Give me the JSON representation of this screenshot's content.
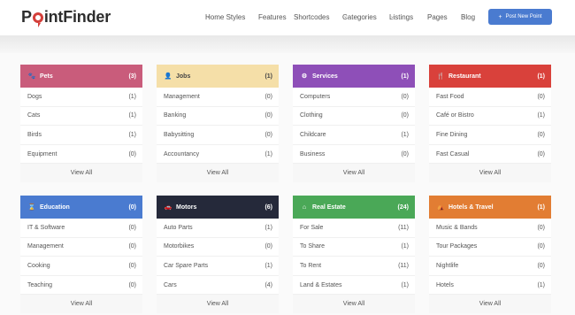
{
  "brand": {
    "name_before": "P",
    "name_after": "intFinder"
  },
  "nav": [
    {
      "label": "Home Styles",
      "dropdown": true
    },
    {
      "label": "Features",
      "dropdown": false
    },
    {
      "label": "Shortcodes",
      "dropdown": true
    },
    {
      "label": "Categories",
      "dropdown": true
    },
    {
      "label": "Listings",
      "dropdown": true
    },
    {
      "label": "Pages",
      "dropdown": true
    },
    {
      "label": "Blog",
      "dropdown": true
    }
  ],
  "post_button": {
    "label": "Post New Point"
  },
  "view_all_label": "View All",
  "categories": [
    {
      "title": "Pets",
      "count": "(3)",
      "color": "#c95c7b",
      "icon": "paw-icon",
      "glyph": "🐾",
      "items": [
        {
          "name": "Dogs",
          "count": "(1)"
        },
        {
          "name": "Cats",
          "count": "(1)"
        },
        {
          "name": "Birds",
          "count": "(1)"
        },
        {
          "name": "Equipment",
          "count": "(0)"
        }
      ]
    },
    {
      "title": "Jobs",
      "count": "(1)",
      "color": "#f5dfa8",
      "text_color": "#444",
      "icon": "user-icon",
      "glyph": "👤",
      "items": [
        {
          "name": "Management",
          "count": "(0)"
        },
        {
          "name": "Banking",
          "count": "(0)"
        },
        {
          "name": "Babysitting",
          "count": "(0)"
        },
        {
          "name": "Accountancy",
          "count": "(1)"
        }
      ]
    },
    {
      "title": "Services",
      "count": "(1)",
      "color": "#8e4fb8",
      "icon": "gears-icon",
      "glyph": "⚙",
      "items": [
        {
          "name": "Computers",
          "count": "(0)"
        },
        {
          "name": "Clothing",
          "count": "(0)"
        },
        {
          "name": "Childcare",
          "count": "(1)"
        },
        {
          "name": "Business",
          "count": "(0)"
        }
      ]
    },
    {
      "title": "Restaurant",
      "count": "(1)",
      "color": "#d9413b",
      "icon": "cutlery-icon",
      "glyph": "🍴",
      "items": [
        {
          "name": "Fast Food",
          "count": "(0)"
        },
        {
          "name": "Café or Bistro",
          "count": "(1)"
        },
        {
          "name": "Fine Dining",
          "count": "(0)"
        },
        {
          "name": "Fast Casual",
          "count": "(0)"
        }
      ]
    },
    {
      "title": "Education",
      "count": "(0)",
      "color": "#4a7bd0",
      "icon": "hourglass-icon",
      "glyph": "⌛",
      "items": [
        {
          "name": "IT & Software",
          "count": "(0)"
        },
        {
          "name": "Management",
          "count": "(0)"
        },
        {
          "name": "Cooking",
          "count": "(0)"
        },
        {
          "name": "Teaching",
          "count": "(0)"
        }
      ]
    },
    {
      "title": "Motors",
      "count": "(6)",
      "color": "#25293a",
      "icon": "car-icon",
      "glyph": "🚗",
      "items": [
        {
          "name": "Auto Parts",
          "count": "(1)"
        },
        {
          "name": "Motorbikes",
          "count": "(0)"
        },
        {
          "name": "Car Spare Parts",
          "count": "(1)"
        },
        {
          "name": "Cars",
          "count": "(4)"
        }
      ]
    },
    {
      "title": "Real Estate",
      "count": "(24)",
      "color": "#4aa857",
      "icon": "home-icon",
      "glyph": "⌂",
      "items": [
        {
          "name": "For Sale",
          "count": "(11)"
        },
        {
          "name": "To Share",
          "count": "(1)"
        },
        {
          "name": "To Rent",
          "count": "(11)"
        },
        {
          "name": "Land & Estates",
          "count": "(1)"
        }
      ]
    },
    {
      "title": "Hotels & Travel",
      "count": "(1)",
      "color": "#e27d33",
      "icon": "tent-icon",
      "glyph": "⛺",
      "items": [
        {
          "name": "Music & Bands",
          "count": "(0)"
        },
        {
          "name": "Tour Packages",
          "count": "(0)"
        },
        {
          "name": "Nightlife",
          "count": "(0)"
        },
        {
          "name": "Hotels",
          "count": "(1)"
        }
      ]
    }
  ]
}
